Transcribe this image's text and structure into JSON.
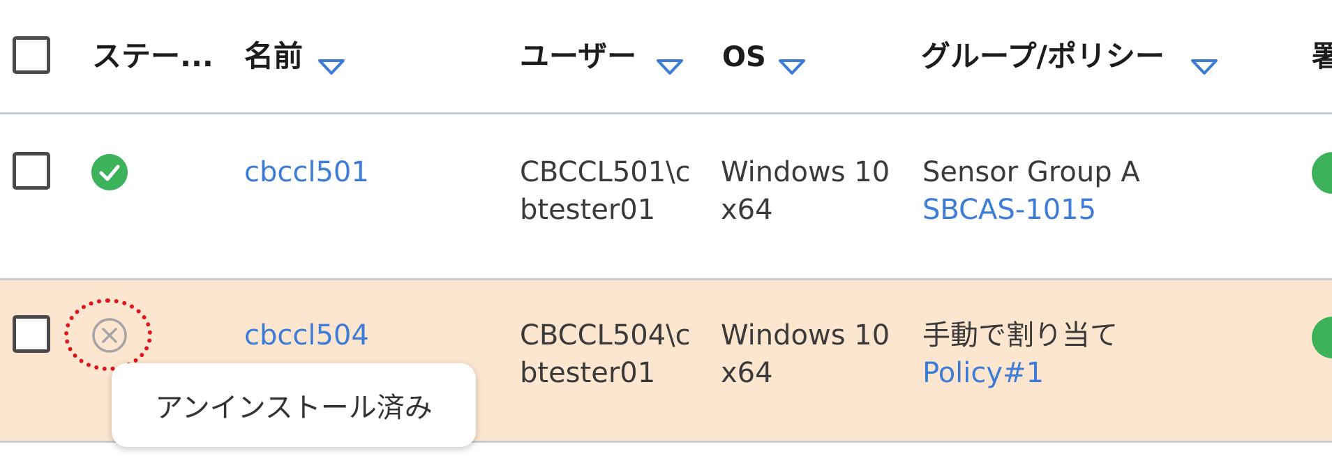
{
  "table": {
    "headers": {
      "status": "ステー...",
      "name": "名前",
      "user": "ユーザー",
      "os": "OS",
      "group_policy": "グループ/ポリシー",
      "truncated_next": "署"
    },
    "rows": [
      {
        "status": "active",
        "name": "cbccl501",
        "user_line1": "CBCCL501\\c",
        "user_line2": "btester01",
        "os_line1": "Windows 10",
        "os_line2": "x64",
        "group": "Sensor Group A",
        "policy": "SBCAS-1015"
      },
      {
        "status": "uninstalled",
        "name": "cbccl504",
        "user_line1": "CBCCL504\\c",
        "user_line2": "btester01",
        "os_line1": "Windows 10",
        "os_line2": "x64",
        "group": "手動で割り当て",
        "policy": "Policy#1"
      }
    ]
  },
  "tooltip": {
    "text": "アンインストール済み"
  },
  "colors": {
    "link": "#3c7bd6",
    "status_ok": "#3cb25a",
    "highlight_row": "#fde6d0",
    "annotation": "#e0141e",
    "sort_icon": "#3c7bd6"
  },
  "icons": {
    "sort": "triangle-down-icon",
    "status_ok": "check-circle-icon",
    "status_uninstalled": "x-circle-icon"
  }
}
